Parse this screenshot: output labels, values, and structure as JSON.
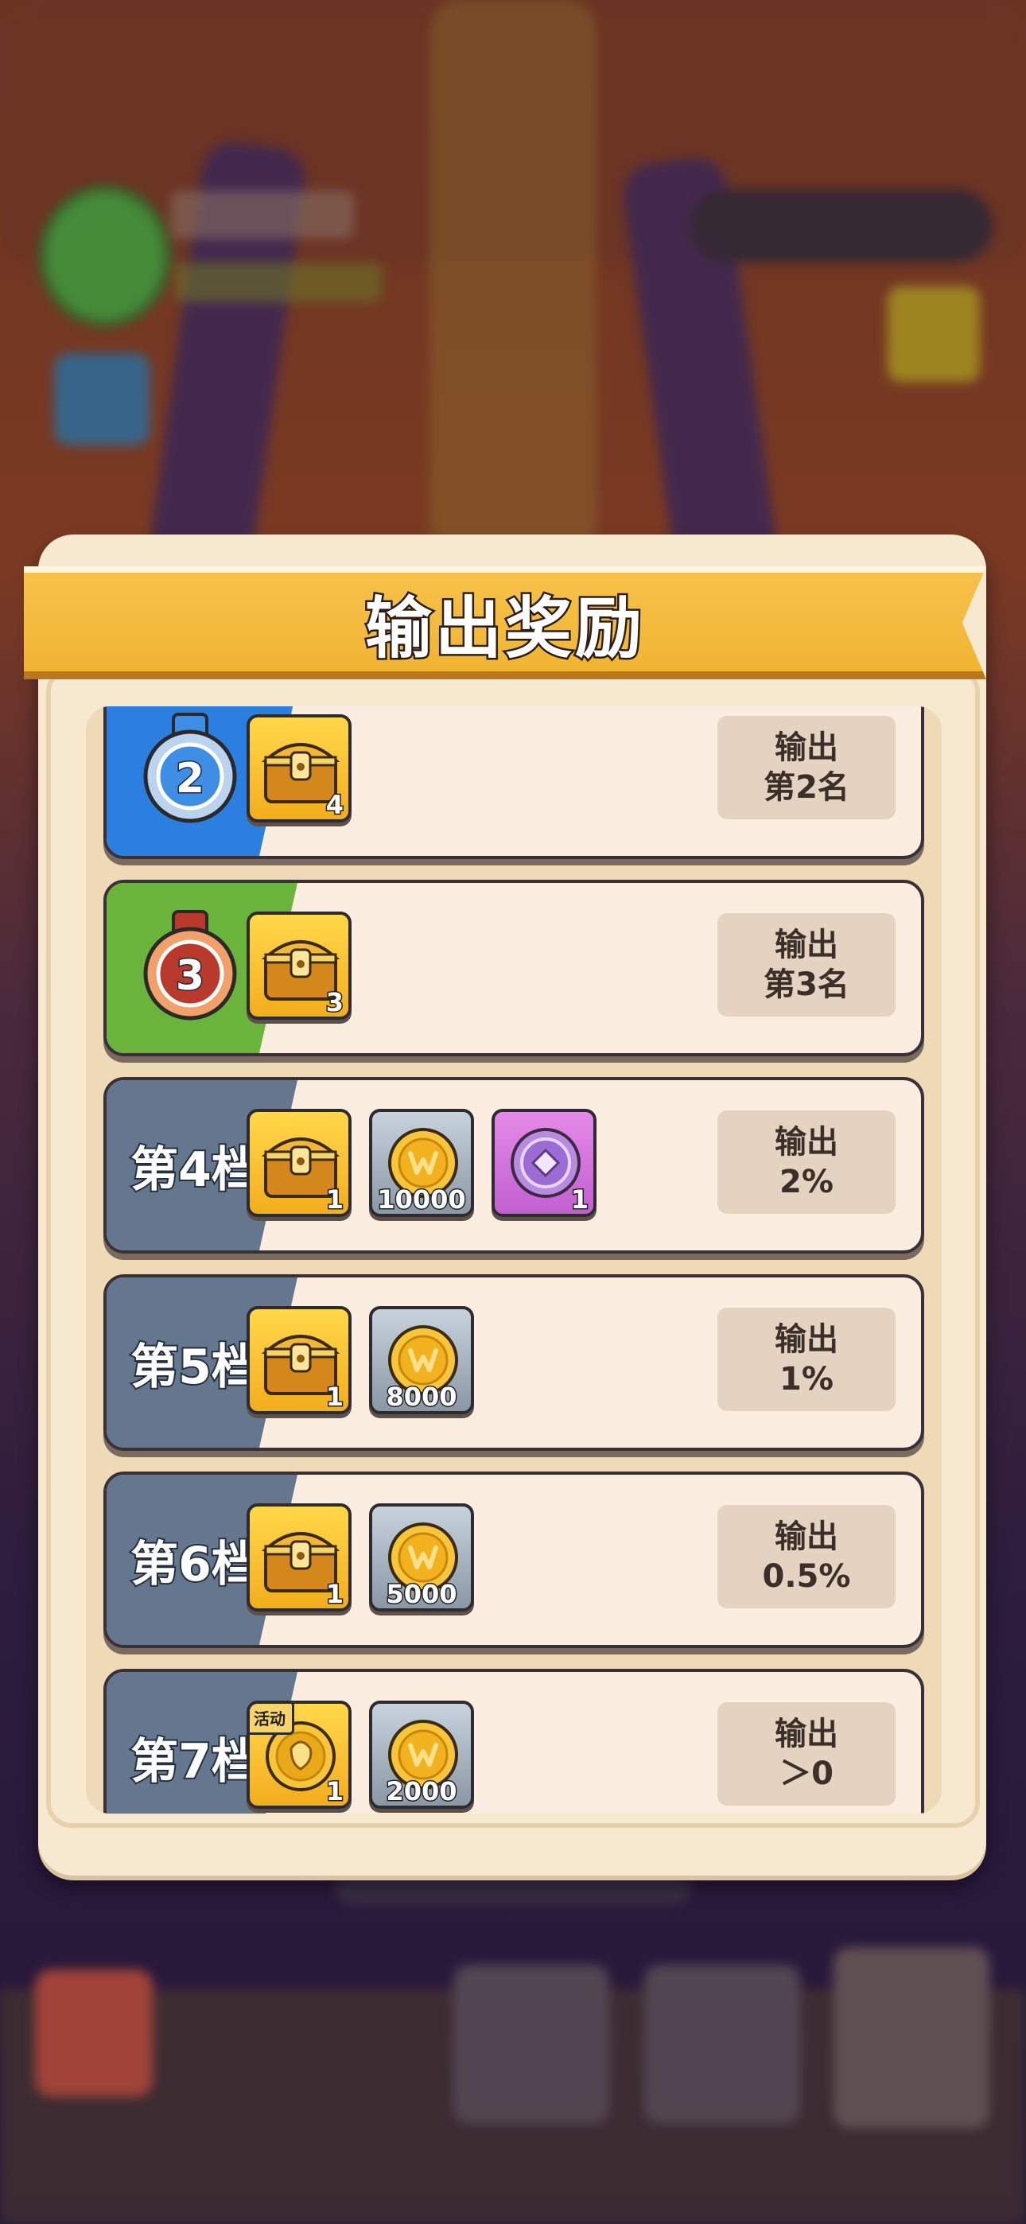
{
  "dialog": {
    "title": "输出奖励"
  },
  "tiers": [
    {
      "label": "",
      "medal": "2",
      "tag_color": "blue",
      "rewards": [
        {
          "icon": "treasure-chest-icon",
          "style": "gold",
          "qty": "4"
        }
      ],
      "requirement": {
        "line1": "输出",
        "line2": "第2名"
      }
    },
    {
      "label": "",
      "medal": "3",
      "tag_color": "green",
      "rewards": [
        {
          "icon": "treasure-chest-icon",
          "style": "gold",
          "qty": "3"
        }
      ],
      "requirement": {
        "line1": "输出",
        "line2": "第3名"
      }
    },
    {
      "label": "第4档",
      "tag_color": "slate",
      "rewards": [
        {
          "icon": "treasure-chest-icon",
          "style": "gold",
          "qty": "1"
        },
        {
          "icon": "gold-coin-icon",
          "style": "silver",
          "qty": "10000"
        },
        {
          "icon": "purple-token-icon",
          "style": "purple",
          "qty": "1"
        }
      ],
      "requirement": {
        "line1": "输出",
        "line2": "2%"
      }
    },
    {
      "label": "第5档",
      "tag_color": "slate",
      "rewards": [
        {
          "icon": "treasure-chest-icon",
          "style": "gold",
          "qty": "1"
        },
        {
          "icon": "gold-coin-icon",
          "style": "silver",
          "qty": "8000"
        }
      ],
      "requirement": {
        "line1": "输出",
        "line2": "1%"
      }
    },
    {
      "label": "第6档",
      "tag_color": "slate",
      "rewards": [
        {
          "icon": "treasure-chest-icon",
          "style": "gold",
          "qty": "1"
        },
        {
          "icon": "gold-coin-icon",
          "style": "silver",
          "qty": "5000"
        }
      ],
      "requirement": {
        "line1": "输出",
        "line2": "0.5%"
      }
    },
    {
      "label": "第7档",
      "tag_color": "slate",
      "rewards": [
        {
          "icon": "event-coin-icon",
          "style": "gold",
          "qty": "1",
          "badge": "活动"
        },
        {
          "icon": "gold-coin-icon",
          "style": "silver",
          "qty": "2000"
        }
      ],
      "requirement": {
        "line1": "输出",
        "line2": "＞0"
      }
    }
  ]
}
